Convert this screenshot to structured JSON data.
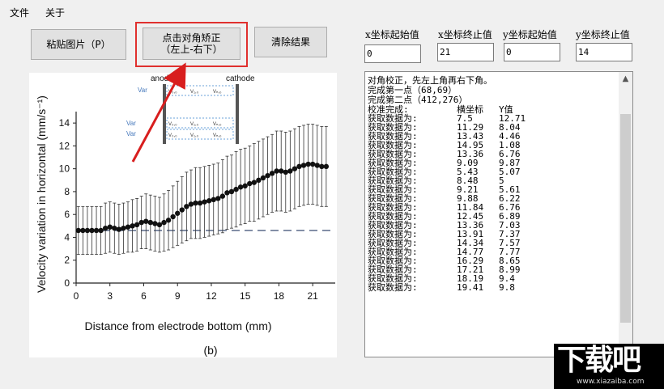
{
  "menu": {
    "file": "文件",
    "about": "关于"
  },
  "buttons": {
    "paste": "粘贴图片（P）",
    "diag_line1": "点击对角矫正",
    "diag_line2": "（左上-右下）",
    "clear": "清除结果"
  },
  "fields": {
    "x_start": {
      "label": "x坐标起始值",
      "value": "0"
    },
    "x_end": {
      "label": "x坐标终止值",
      "value": "21"
    },
    "y_start": {
      "label": "y坐标起始值",
      "value": "0"
    },
    "y_end": {
      "label": "y坐标终止值",
      "value": "14"
    }
  },
  "output": {
    "header_lines": [
      "对角校正，先左上角再右下角。",
      "完成第一点（68,69）",
      "完成第二点（412,276）"
    ],
    "columns": [
      "校准完成:",
      "横坐标",
      "Y值"
    ],
    "row_prefix": "获取数据为:",
    "rows": [
      [
        "7.5",
        "12.71"
      ],
      [
        "11.29",
        "8.04"
      ],
      [
        "13.43",
        "4.46"
      ],
      [
        "14.95",
        "1.08"
      ],
      [
        "13.36",
        "6.76"
      ],
      [
        "9.09",
        "9.87"
      ],
      [
        "5.43",
        "5.07"
      ],
      [
        "8.48",
        "5"
      ],
      [
        "9.21",
        "5.61"
      ],
      [
        "9.88",
        "6.22"
      ],
      [
        "11.84",
        "6.76"
      ],
      [
        "12.45",
        "6.89"
      ],
      [
        "13.36",
        "7.03"
      ],
      [
        "13.91",
        "7.37"
      ],
      [
        "14.34",
        "7.57"
      ],
      [
        "14.77",
        "7.77"
      ],
      [
        "16.29",
        "8.65"
      ],
      [
        "17.21",
        "8.99"
      ],
      [
        "18.19",
        "9.4"
      ],
      [
        "19.41",
        "9.8"
      ]
    ]
  },
  "chart_data": {
    "type": "scatter",
    "title": "",
    "caption": "(b)",
    "xlabel": "Distance from electrode bottom (mm)",
    "ylabel": "Velocity variation in horizontal (mm/s⁻¹)",
    "xlim": [
      0,
      23
    ],
    "ylim": [
      0,
      15
    ],
    "xticks": [
      "0",
      "3",
      "6",
      "9",
      "12",
      "15",
      "18",
      "21"
    ],
    "yticks": [
      "0",
      "2",
      "4",
      "6",
      "8",
      "10",
      "12",
      "14"
    ],
    "reference_y": 4.6,
    "x": [
      0.2,
      0.6,
      1.0,
      1.4,
      1.8,
      2.2,
      2.6,
      3.0,
      3.4,
      3.8,
      4.2,
      4.6,
      5.0,
      5.4,
      5.8,
      6.2,
      6.6,
      7.0,
      7.4,
      7.8,
      8.2,
      8.6,
      9.0,
      9.4,
      9.8,
      10.2,
      10.6,
      11.0,
      11.4,
      11.8,
      12.2,
      12.6,
      13.0,
      13.4,
      13.8,
      14.2,
      14.6,
      15.0,
      15.4,
      15.8,
      16.2,
      16.6,
      17.0,
      17.4,
      17.8,
      18.2,
      18.6,
      19.0,
      19.4,
      19.8,
      20.2,
      20.6,
      21.0,
      21.4,
      21.8,
      22.2
    ],
    "y": [
      4.6,
      4.6,
      4.6,
      4.6,
      4.6,
      4.6,
      4.8,
      4.9,
      4.8,
      4.7,
      4.8,
      4.9,
      5.0,
      5.1,
      5.3,
      5.4,
      5.3,
      5.2,
      5.1,
      5.3,
      5.5,
      5.8,
      6.1,
      6.4,
      6.7,
      6.9,
      7.0,
      7.0,
      7.1,
      7.2,
      7.3,
      7.4,
      7.6,
      7.9,
      8.0,
      8.2,
      8.4,
      8.5,
      8.7,
      8.8,
      9.0,
      9.2,
      9.4,
      9.6,
      9.8,
      9.8,
      9.7,
      9.8,
      10.0,
      10.2,
      10.3,
      10.4,
      10.4,
      10.3,
      10.2,
      10.2
    ],
    "err": [
      2.1,
      2.1,
      2.1,
      2.1,
      2.1,
      2.1,
      2.2,
      2.2,
      2.2,
      2.2,
      2.2,
      2.2,
      2.3,
      2.3,
      2.3,
      2.4,
      2.4,
      2.4,
      2.4,
      2.5,
      2.6,
      2.7,
      2.8,
      2.9,
      3.0,
      3.0,
      3.1,
      3.1,
      3.1,
      3.1,
      3.1,
      3.1,
      3.2,
      3.2,
      3.2,
      3.3,
      3.3,
      3.3,
      3.3,
      3.4,
      3.4,
      3.4,
      3.4,
      3.4,
      3.5,
      3.5,
      3.5,
      3.5,
      3.5,
      3.5,
      3.5,
      3.5,
      3.5,
      3.5,
      3.5,
      3.5
    ],
    "inset": {
      "anode_label": "anode",
      "cathode_label": "cathode",
      "row_label": "Var",
      "cells": [
        "V₀,₀",
        "V₁,₀",
        "Vₙ,₀"
      ]
    }
  },
  "watermark": {
    "main": "下载吧",
    "url": "www.xiazaiba.com"
  },
  "colors": {
    "highlight": "#e0302e",
    "arrow": "#d81e1e",
    "button": "#e1e1e1",
    "window": "#f0f0f0"
  }
}
